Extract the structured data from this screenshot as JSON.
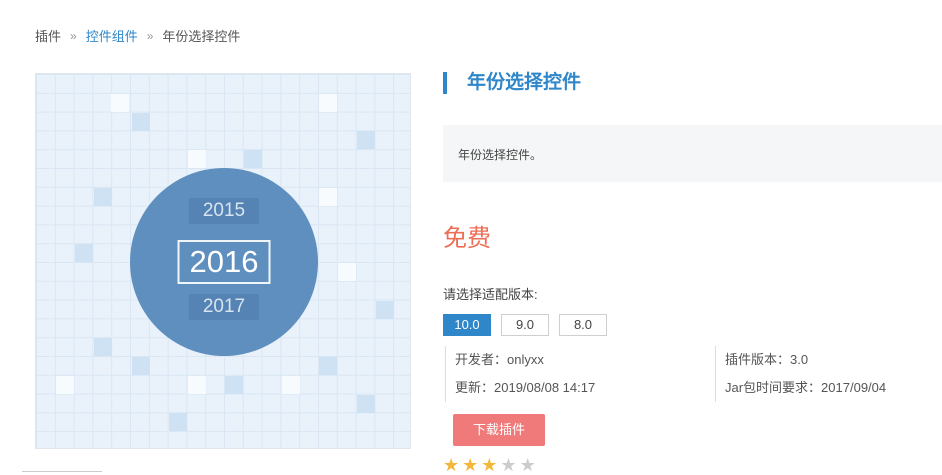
{
  "breadcrumb": {
    "root": "插件",
    "separator1": "»",
    "category": "控件组件",
    "separator2": "»",
    "current": "年份选择控件"
  },
  "preview": {
    "year_prev": "2015",
    "year_current": "2016",
    "year_next": "2017"
  },
  "product": {
    "title": "年份选择控件",
    "description": "年份选择控件。",
    "price": "免费",
    "version_label": "请选择适配版本:",
    "versions": [
      "10.0",
      "9.0",
      "8.0"
    ],
    "selected_version": "10.0",
    "developer": "开发者：onlyxx",
    "updated": "更新：2019/08/08 14:17",
    "plugin_version": "插件版本：3.0",
    "jar_time": "Jar包时间要求：2017/09/04",
    "download_label": "下载插件",
    "rating": 3,
    "rating_max": 5,
    "star_glyph": "★"
  },
  "colors": {
    "accent": "#2f86c9",
    "price": "#ee6d55",
    "download": "#f0797a",
    "star_on": "#f3b73a",
    "star_off": "#cccccc"
  }
}
